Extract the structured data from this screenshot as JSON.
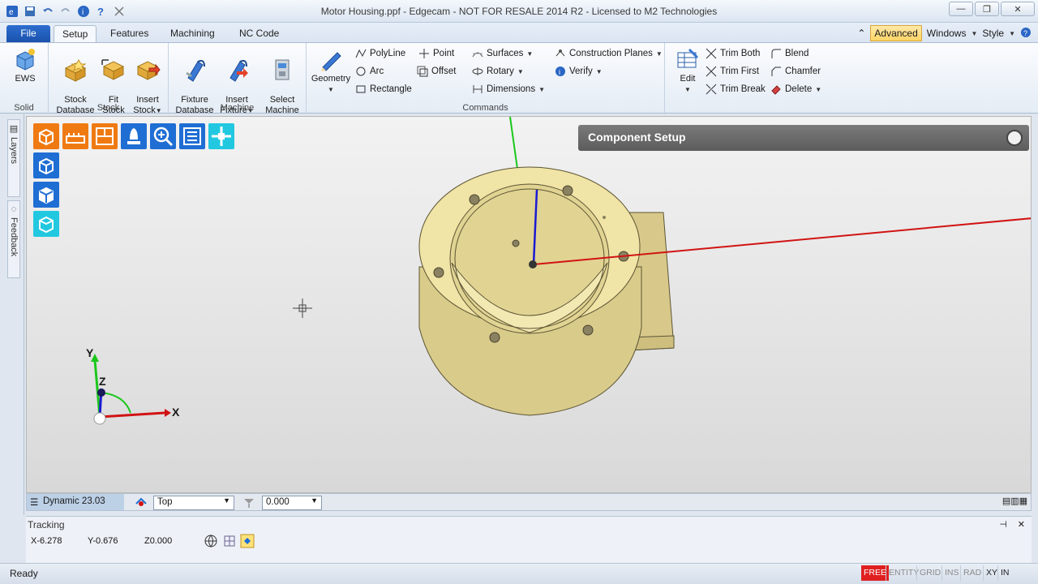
{
  "window": {
    "title": "Motor Housing.ppf - Edgecam - NOT FOR RESALE 2014 R2 - Licensed to M2 Technologies"
  },
  "tabs": {
    "file": "File",
    "items": [
      "Setup",
      "Features",
      "Machining",
      "NC Code"
    ],
    "active": "Setup"
  },
  "right_controls": {
    "advanced": "Advanced",
    "windows": "Windows",
    "style": "Style"
  },
  "ribbon": {
    "solid": {
      "label": "Solid",
      "ews": "EWS"
    },
    "stock": {
      "label": "Stock",
      "stock_database": "Stock\nDatabase",
      "fit_stock": "Fit\nStock",
      "insert_stock": "Insert\nStock"
    },
    "machine": {
      "label": "Machine",
      "fixture_database": "Fixture\nDatabase",
      "insert_fixture": "Insert\nFixture",
      "select_machine": "Select\nMachine"
    },
    "commands": {
      "label": "Commands",
      "geometry": "Geometry",
      "polyline": "PolyLine",
      "arc": "Arc",
      "rectangle": "Rectangle",
      "point": "Point",
      "offset": "Offset",
      "surfaces": "Surfaces",
      "rotary": "Rotary",
      "dimensions": "Dimensions",
      "construction_planes": "Construction Planes",
      "verify": "Verify"
    },
    "edit": {
      "edit": "Edit",
      "trim_both": "Trim Both",
      "trim_first": "Trim First",
      "trim_break": "Trim Break",
      "blend": "Blend",
      "chamfer": "Chamfer",
      "delete": "Delete"
    }
  },
  "side_tabs": {
    "layers": "Layers",
    "feedback": "Feedback"
  },
  "viewport": {
    "panel_title": "Component Setup",
    "triad": {
      "y": "Y",
      "z": "Z",
      "x": "X"
    }
  },
  "view_bar": {
    "dynamic": "Dynamic 23.03",
    "view": "Top",
    "depth": "0.000"
  },
  "tracking": {
    "title": "Tracking",
    "x": "X-6.278",
    "y": "Y-0.676",
    "z": "Z0.000"
  },
  "status": {
    "ready": "Ready",
    "flags": [
      "FREE",
      "ENTITY",
      "GRID",
      "INS",
      "RAD",
      "XY",
      "IN"
    ]
  },
  "colors": {
    "accent": "#1a52ad",
    "part": "#efe3a6",
    "free_flag": "#e02020",
    "x_axis": "#d11313",
    "y_axis": "#1bc71b",
    "z_axis": "#1a1ad1"
  }
}
